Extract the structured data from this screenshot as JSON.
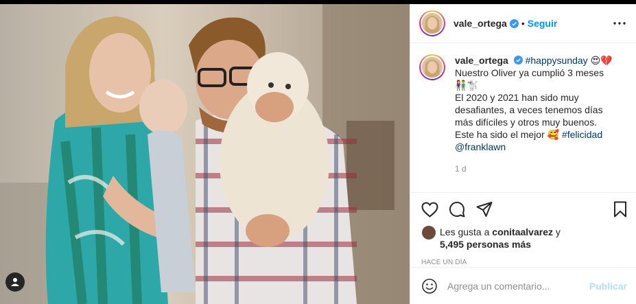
{
  "post": {
    "username": "vale_ortega",
    "follow_label": "Seguir",
    "dot": "•",
    "caption": {
      "line1_tags": "#happysunday",
      "line1_emoji": "😍💔",
      "line2": "Nuestro Oliver ya cumplió 3 meses",
      "line3_emoji": "👫🐩",
      "line4": "El 2020 y 2021 han sido muy desafiantes, a veces tenemos días más difíciles y otros muy buenos. Este ha sido el mejor",
      "line4_emoji": "🥰",
      "tag_felicidad": "#felicidad",
      "mention": "@franklawn",
      "time": "1 d"
    },
    "likes": {
      "prefix": "Les gusta a",
      "user": "conitaalvarez",
      "connector": "y",
      "count": "5,495 personas más"
    },
    "date": "Hace un día",
    "comment": {
      "placeholder": "Agrega un comentario...",
      "publish": "Publicar"
    }
  },
  "colors": {
    "link_blue": "#0095f6",
    "hashtag_blue": "#00376b",
    "muted": "#8e8e8e",
    "publish_disabled": "#b2dffc",
    "verified": "#3897f0"
  },
  "icons": [
    "more-options-icon",
    "verified-badge-icon",
    "heart-icon",
    "comment-icon",
    "share-icon",
    "bookmark-icon",
    "emoji-icon",
    "user-tag-icon"
  ]
}
